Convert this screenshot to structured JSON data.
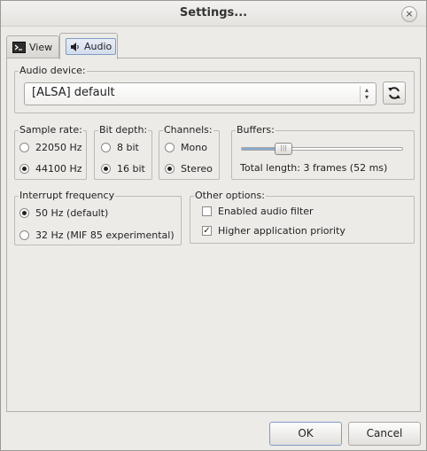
{
  "window": {
    "title": "Settings...",
    "close_glyph": "×"
  },
  "tabs": [
    {
      "label": "View",
      "icon": "terminal-icon",
      "active": false
    },
    {
      "label": "Audio",
      "icon": "speaker-icon",
      "active": true
    }
  ],
  "audio_device": {
    "legend": "Audio device:",
    "selected": "[ALSA] default",
    "refresh_icon": "refresh-icon"
  },
  "sample_rate": {
    "legend": "Sample rate:",
    "options": [
      "22050 Hz",
      "44100 Hz"
    ],
    "selected": "44100 Hz"
  },
  "bit_depth": {
    "legend": "Bit depth:",
    "options": [
      "8 bit",
      "16 bit"
    ],
    "selected": "16 bit"
  },
  "channels": {
    "legend": "Channels:",
    "options": [
      "Mono",
      "Stereo"
    ],
    "selected": "Stereo"
  },
  "buffers": {
    "legend": "Buffers:",
    "slider_fraction": 0.26,
    "total_length": "Total length: 3 frames (52 ms)"
  },
  "interrupt_frequency": {
    "legend": "Interrupt frequency",
    "options": [
      "50 Hz (default)",
      "32 Hz (MIF 85 experimental)"
    ],
    "selected": "50 Hz (default)"
  },
  "other_options": {
    "legend": "Other options:",
    "items": [
      {
        "label": "Enabled audio filter",
        "checked": false
      },
      {
        "label": "Higher application priority",
        "checked": true
      }
    ]
  },
  "buttons": {
    "ok": "OK",
    "cancel": "Cancel"
  },
  "colors": {
    "accent": "#87a9d4",
    "focus_border": "#7e9cc2"
  }
}
